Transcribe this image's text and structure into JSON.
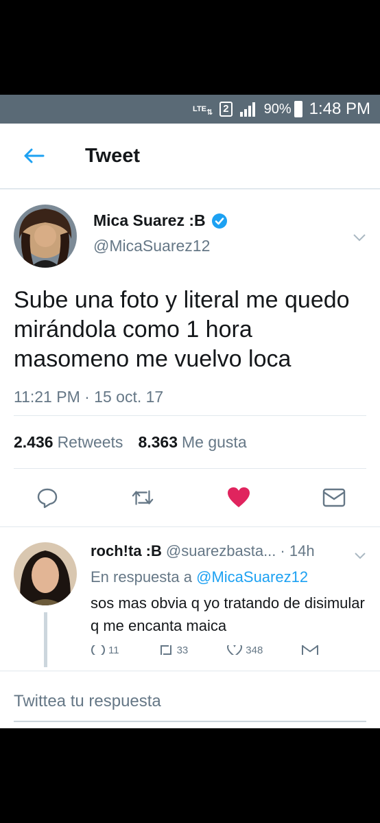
{
  "status_bar": {
    "network": "LTE",
    "sim": "2",
    "battery": "90%",
    "time": "1:48 PM"
  },
  "app_bar": {
    "title": "Tweet",
    "back_icon": "arrow-left-icon",
    "accent": "#1da1f2"
  },
  "tweet": {
    "display_name": "Mica Suarez :B",
    "handle": "@MicaSuarez12",
    "verified": true,
    "text": "Sube una foto y literal me quedo mirándola como 1 hora masomeno me vuelvo loca",
    "timestamp": "11:21 PM · 15 oct. 17",
    "retweets_count": "2.436",
    "retweets_label": "Retweets",
    "likes_count": "8.363",
    "likes_label": "Me gusta",
    "liked": true,
    "like_color": "#e0245e",
    "actions": [
      "reply-icon",
      "retweet-icon",
      "heart-icon",
      "message-icon"
    ]
  },
  "reply": {
    "display_name": "roch!ta :B",
    "handle": "@suarezbasta...",
    "time": "· 14h",
    "in_reply_prefix": "En respuesta a",
    "in_reply_mention": "@MicaSuarez12",
    "text": "sos mas obvia q yo tratando de disimular q me encanta maica",
    "reply_count": "11",
    "retweet_count": "33",
    "like_count": "348"
  },
  "composer": {
    "placeholder": "Twittea tu respuesta"
  }
}
